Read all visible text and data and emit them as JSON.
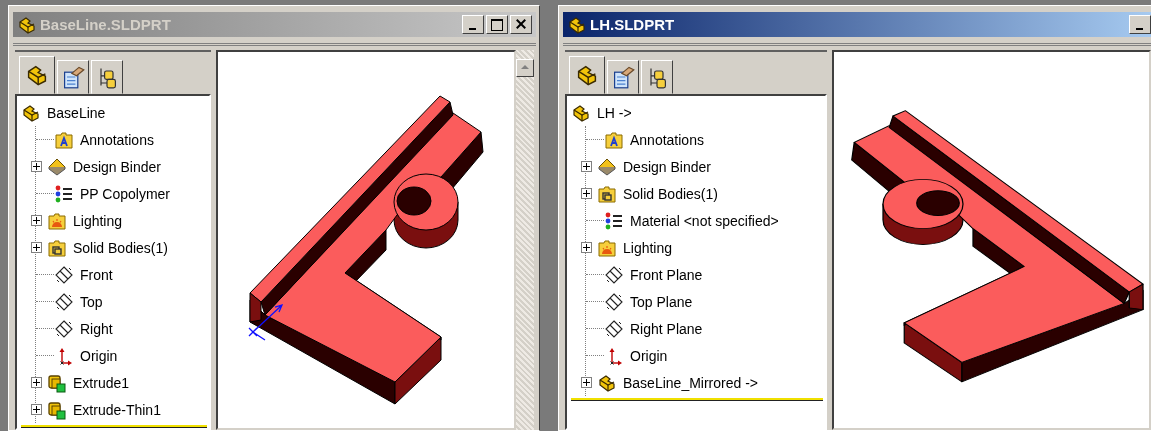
{
  "windows": [
    {
      "title": "BaseLine.SLDPRT",
      "active": false,
      "controls": [
        {
          "kind": "minimize"
        },
        {
          "kind": "maximize"
        },
        {
          "kind": "close"
        }
      ],
      "scrollbar": true,
      "tabs": [
        {
          "kind": "feature",
          "selected": true
        },
        {
          "kind": "property",
          "selected": false
        },
        {
          "kind": "config",
          "selected": false
        }
      ],
      "model": {
        "mirrored": false,
        "triad": true
      },
      "tree": {
        "label": "BaseLine",
        "kind": "part",
        "children": [
          {
            "label": "Annotations",
            "kind": "annotations",
            "collapsed": false
          },
          {
            "label": "Design Binder",
            "kind": "binder",
            "collapsed": true
          },
          {
            "label": "PP Copolymer",
            "kind": "material",
            "collapsed": false
          },
          {
            "label": "Lighting",
            "kind": "lighting",
            "collapsed": true
          },
          {
            "label": "Solid Bodies(1)",
            "kind": "bodies",
            "collapsed": true
          },
          {
            "label": "Front",
            "kind": "plane",
            "collapsed": false
          },
          {
            "label": "Top",
            "kind": "plane",
            "collapsed": false
          },
          {
            "label": "Right",
            "kind": "plane",
            "collapsed": false
          },
          {
            "label": "Origin",
            "kind": "origin",
            "collapsed": false
          },
          {
            "label": "Extrude1",
            "kind": "feature",
            "collapsed": true
          },
          {
            "label": "Extrude-Thin1",
            "kind": "feature",
            "collapsed": true
          }
        ]
      }
    },
    {
      "title": "LH.SLDPRT",
      "active": true,
      "controls": [
        {
          "kind": "minimize"
        }
      ],
      "scrollbar": false,
      "tabs": [
        {
          "kind": "feature",
          "selected": true
        },
        {
          "kind": "property",
          "selected": false
        },
        {
          "kind": "config",
          "selected": false
        }
      ],
      "model": {
        "mirrored": true,
        "triad": false
      },
      "tree": {
        "label": "LH ->",
        "kind": "part",
        "children": [
          {
            "label": "Annotations",
            "kind": "annotations",
            "collapsed": false
          },
          {
            "label": "Design Binder",
            "kind": "binder",
            "collapsed": true
          },
          {
            "label": "Solid Bodies(1)",
            "kind": "bodies",
            "collapsed": true
          },
          {
            "label": "Material <not specified>",
            "kind": "material",
            "collapsed": false
          },
          {
            "label": "Lighting",
            "kind": "lighting",
            "collapsed": true
          },
          {
            "label": "Front Plane",
            "kind": "plane",
            "collapsed": false
          },
          {
            "label": "Top Plane",
            "kind": "plane",
            "collapsed": false
          },
          {
            "label": "Right Plane",
            "kind": "plane",
            "collapsed": false
          },
          {
            "label": "Origin",
            "kind": "origin",
            "collapsed": false
          },
          {
            "label": "BaseLine_Mirrored ->",
            "kind": "part",
            "collapsed": true
          }
        ]
      }
    }
  ]
}
